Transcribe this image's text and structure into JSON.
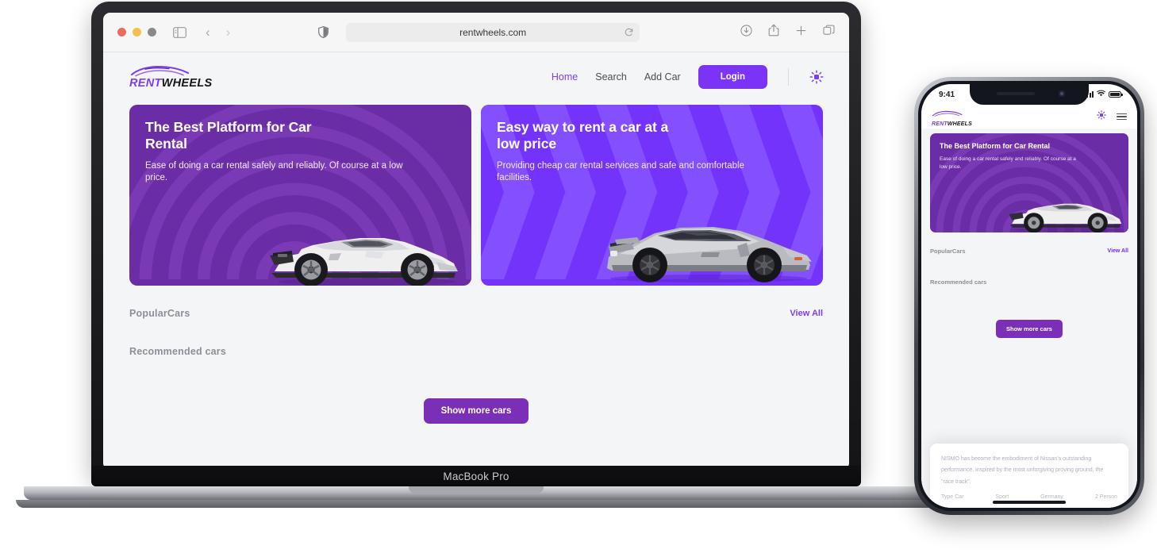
{
  "browser": {
    "url": "rentwheels.com",
    "icons": {
      "sidebar": "sidebar-icon",
      "back": "back-arrow-icon",
      "forward": "forward-arrow-icon",
      "shield": "privacy-shield-icon",
      "reload": "reload-icon",
      "download": "download-icon",
      "share": "share-icon",
      "new_tab": "plus-icon",
      "tabs": "tabs-icon"
    }
  },
  "device": {
    "laptop_label": "MacBook Pro"
  },
  "site": {
    "logo": {
      "part1": "RENT",
      "part2": "WHEELS",
      "mark": "car-swoosh-icon"
    },
    "nav": [
      {
        "label": "Home",
        "active": true
      },
      {
        "label": "Search",
        "active": false
      },
      {
        "label": "Add Car",
        "active": false
      }
    ],
    "login_label": "Login",
    "theme_toggle": "sun-icon",
    "colors": {
      "brand_purple": "#7b3ff2",
      "login_purple": "#7b33f5",
      "hero_a": "#6b2da5",
      "hero_b": "#7433fb",
      "button_purple": "#7b2fb8",
      "page_bg": "#f4f5f7",
      "muted_text": "#8e8e97"
    }
  },
  "heroes": [
    {
      "title": "The Best Platform for Car Rental",
      "subtitle": "Ease of doing a car rental safely and reliably. Of course at a low price.",
      "car": "white-supercar-image",
      "pattern": "concentric-rings"
    },
    {
      "title": "Easy way to rent a car at a low price",
      "subtitle": "Providing cheap car rental services and safe and comfortable facilities.",
      "car": "silver-gtr-image",
      "pattern": "chevrons"
    }
  ],
  "sections": {
    "popular_title": "PopularCars",
    "view_all": "View All",
    "recommended_title": "Recommended cars",
    "show_more": "Show more cars"
  },
  "phone": {
    "status": {
      "time": "9:41",
      "signal": "cellular-signal-icon",
      "wifi": "wifi-icon",
      "battery": "battery-icon"
    },
    "header": {
      "menu": "hamburger-menu-icon",
      "theme_toggle": "sun-icon"
    },
    "hero": {
      "title": "The Best Platform for Car Rental",
      "subtitle": "Ease of doing a car rental safely and reliably. Of course at a low price."
    },
    "sections": {
      "popular_title": "PopularCars",
      "view_all": "View All",
      "recommended_title": "Recommended cars",
      "show_more": "Show more cars"
    },
    "modal": {
      "description": "NISMO has become the embodiment of Nissan's outstanding performance, inspired by the most unforgiving proving ground, the \"race track\".",
      "specs": [
        "Type Car",
        "Sport",
        "Germany",
        "2 Person"
      ]
    }
  }
}
